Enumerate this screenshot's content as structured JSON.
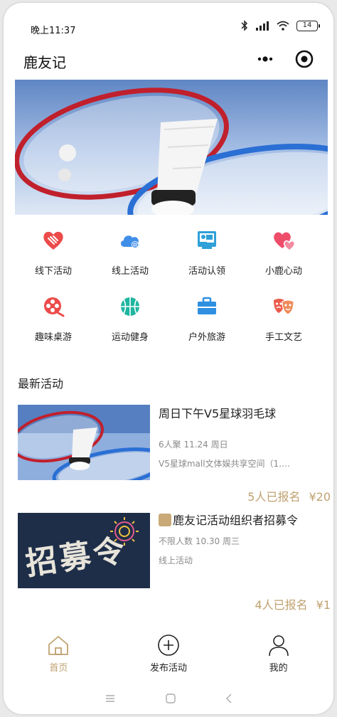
{
  "status_bar": {
    "time": "晚上11:37",
    "battery": "14"
  },
  "nav": {
    "title": "鹿友记"
  },
  "categories": [
    {
      "label": "线下活动",
      "icon": "heart-hands-icon",
      "color": "#ec4b4b"
    },
    {
      "label": "线上活动",
      "icon": "cloud-icon",
      "color": "#3f8ee8"
    },
    {
      "label": "活动认领",
      "icon": "presentation-icon",
      "color": "#2fa0d8"
    },
    {
      "label": "小鹿心动",
      "icon": "double-heart-icon",
      "color": "#ee4d6a"
    },
    {
      "label": "趣味桌游",
      "icon": "film-reel-icon",
      "color": "#ec4b4b"
    },
    {
      "label": "运动健身",
      "icon": "ball-icon",
      "color": "#1fb6a0"
    },
    {
      "label": "户外旅游",
      "icon": "suitcase-icon",
      "color": "#2f8fe0"
    },
    {
      "label": "手工文艺",
      "icon": "masks-icon",
      "color": "#ec5a4b"
    }
  ],
  "section_title": "最新活动",
  "activities": [
    {
      "title": "周日下午V5星球羽毛球",
      "meta": "6人聚   11.24 周日",
      "location": "V5星球mall文体娱共享空间（1.…",
      "signed": "5人已报名",
      "price": "¥20",
      "thumb": "badminton-image"
    },
    {
      "title": "鹿友记活动组织者招募令",
      "meta": "不限人数   10.30 周三",
      "location": "线上活动",
      "signed": "4人已报名",
      "price": "¥1",
      "thumb_text": "招募令"
    }
  ],
  "tabs": [
    {
      "label": "首页",
      "icon": "home-icon",
      "active": true
    },
    {
      "label": "发布活动",
      "icon": "plus-circle-icon",
      "active": false
    },
    {
      "label": "我的",
      "icon": "user-icon",
      "active": false
    }
  ],
  "colors": {
    "accent": "#bfa16f",
    "text": "#222222",
    "muted": "#8a8a8a"
  }
}
